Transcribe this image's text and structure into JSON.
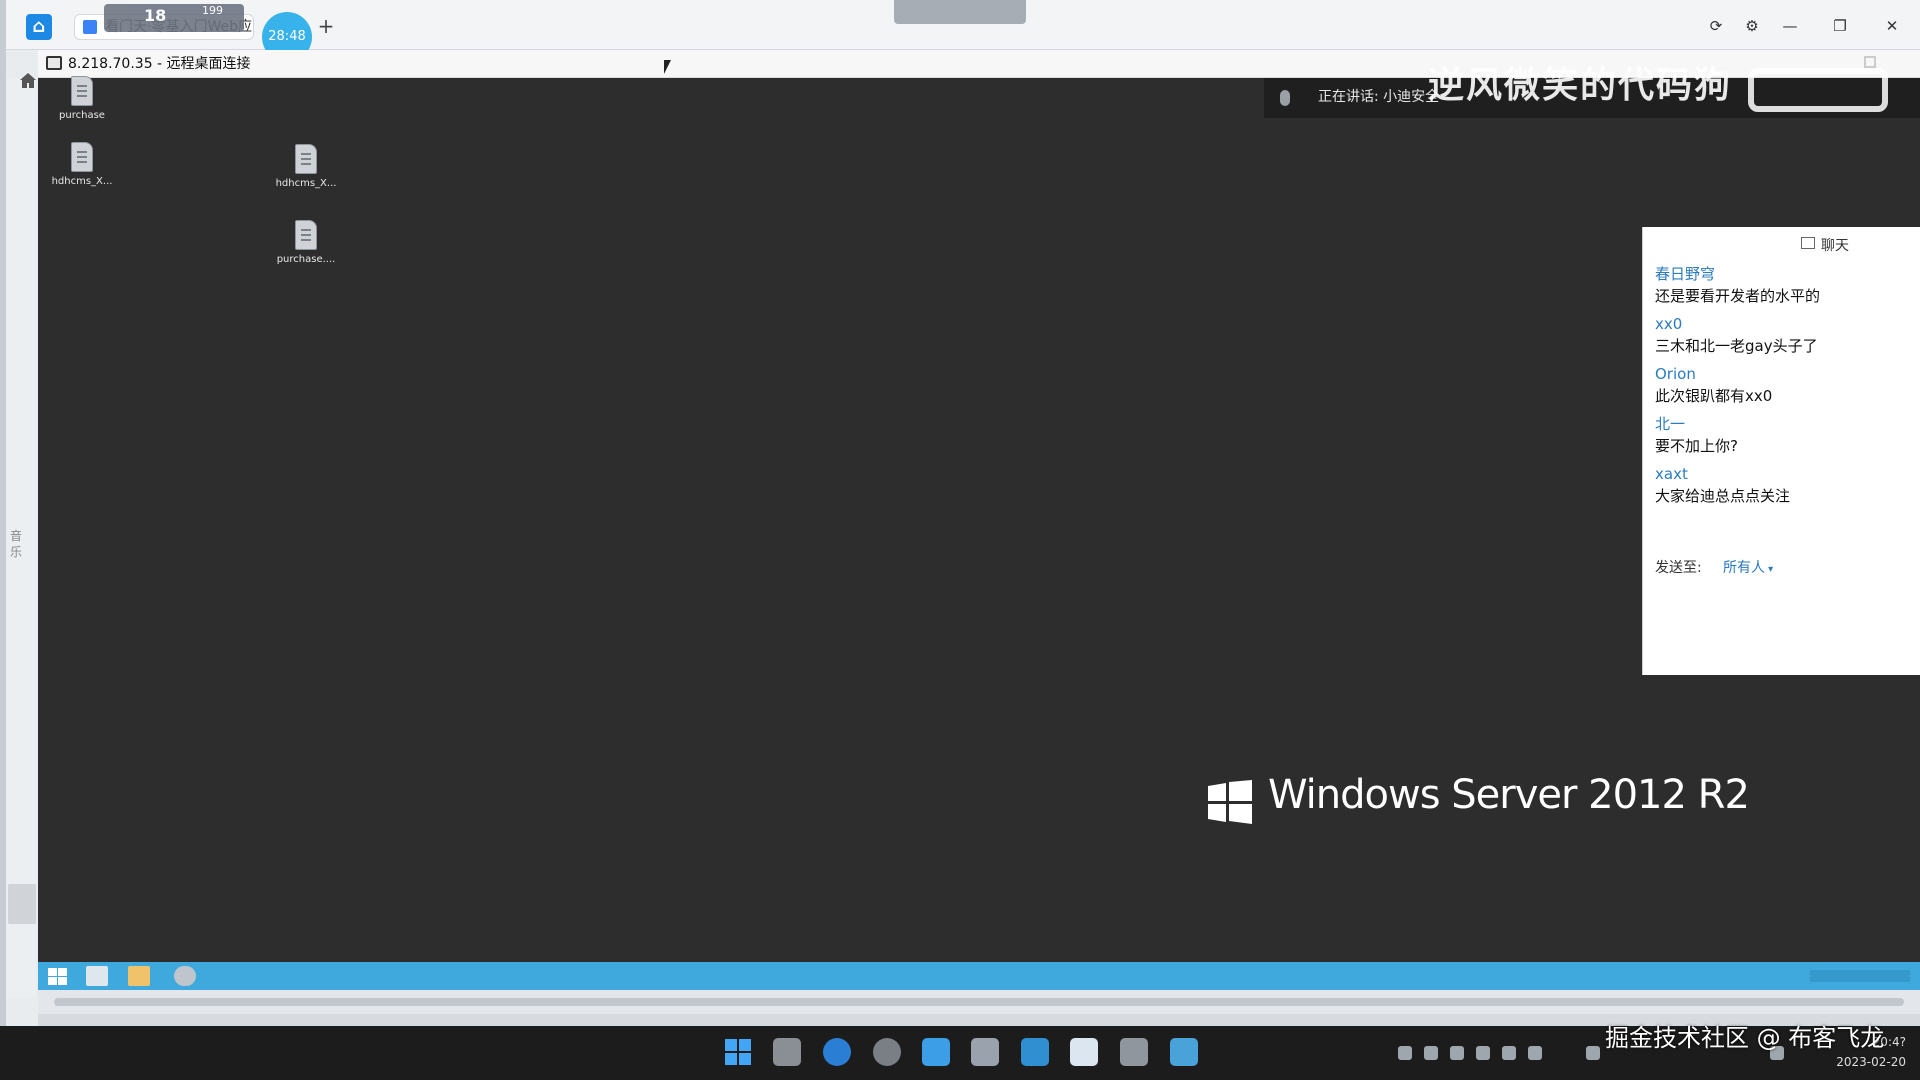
{
  "host": {
    "tab_title": "看门天·零基入门Web应",
    "viewer_count": "18",
    "viewer_count2": "199",
    "timer": "28:48",
    "new_tab_symbol": "+",
    "window_controls": [
      "⟳",
      "⚙",
      "—",
      "❐",
      "✕"
    ]
  },
  "rdp": {
    "title": "8.218.70.35 - 远程桌面连接"
  },
  "desktop": {
    "icons": [
      {
        "label": "purchase"
      },
      {
        "label": "hdhcms_X..."
      },
      {
        "label": "hdhcms_X..."
      },
      {
        "label": "purchase...."
      }
    ],
    "os_label": "Windows Server 2012 R2"
  },
  "meeting": {
    "speaking": "正在讲话: 小迪安全",
    "overlay_watermark": "逆风微笑的代码狗",
    "side_chars": "音 乐"
  },
  "chat": {
    "title": "聊天",
    "messages": [
      {
        "user": "春日野穹",
        "text": "还是要看开发者的水平的"
      },
      {
        "user": "xx0",
        "text": "三木和北一老gay头子了"
      },
      {
        "user": "Orion",
        "text": "此次银趴都有xx0"
      },
      {
        "user": "北一",
        "text": "要不加上你?"
      },
      {
        "user": "xaxt",
        "text": "大家给迪总点点关注"
      }
    ],
    "send_to_label": "发送至:",
    "send_to_value": "所有人"
  },
  "taskbar": {
    "time": "20:4?",
    "date": "2023-02-20"
  },
  "watermark": "掘金技术社区 @ 布客飞龙",
  "colors": {
    "remote_bg": "#2d2d2d",
    "remote_taskbar": "#3fa9dd",
    "chat_user": "#2b7bc0",
    "host_taskbar": "#1c1c1c"
  }
}
